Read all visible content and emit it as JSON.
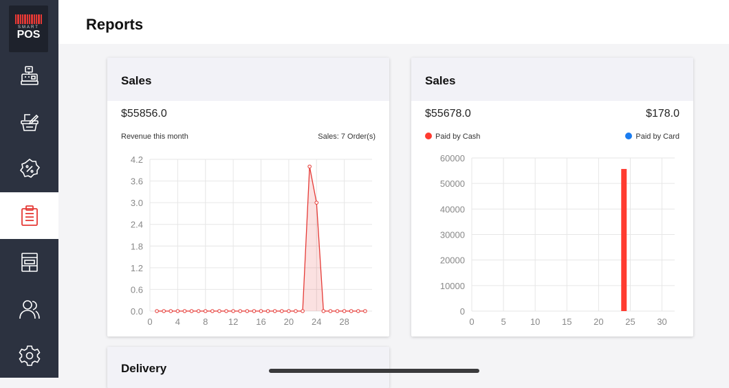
{
  "app": {
    "logo_small": "SMART",
    "logo_big": "POS"
  },
  "sidebar": {
    "items": [
      {
        "name": "register",
        "icon": "cash-register-icon",
        "active": false
      },
      {
        "name": "products",
        "icon": "basket-edit-icon",
        "active": false
      },
      {
        "name": "discounts",
        "icon": "percent-badge-icon",
        "active": false
      },
      {
        "name": "reports",
        "icon": "clipboard-icon",
        "active": true
      },
      {
        "name": "store",
        "icon": "storefront-icon",
        "active": false
      },
      {
        "name": "customers",
        "icon": "users-icon",
        "active": false
      },
      {
        "name": "settings",
        "icon": "gear-icon",
        "active": false
      }
    ],
    "accent": "#e53935"
  },
  "header": {
    "title": "Reports"
  },
  "cards": {
    "sales_trend": {
      "title": "Sales",
      "amount": "$55856.0",
      "revenue_label": "Revenue this month",
      "orders_label": "Sales: 7 Order(s)"
    },
    "sales_payment": {
      "title": "Sales",
      "cash_amount": "$55678.0",
      "card_amount": "$178.0",
      "cash_label": "Paid by Cash",
      "card_label": "Paid by Card",
      "cash_color": "#ff3b30",
      "card_color": "#1a7cf0"
    },
    "delivery": {
      "title": "Delivery"
    }
  },
  "chart_data": [
    {
      "type": "line",
      "x": [
        1,
        2,
        3,
        4,
        5,
        6,
        7,
        8,
        9,
        10,
        11,
        12,
        13,
        14,
        15,
        16,
        17,
        18,
        19,
        20,
        21,
        22,
        23,
        24,
        25,
        26,
        27,
        28,
        29,
        30,
        31
      ],
      "series": [
        {
          "values": [
            0,
            0,
            0,
            0,
            0,
            0,
            0,
            0,
            0,
            0,
            0,
            0,
            0,
            0,
            0,
            0,
            0,
            0,
            0,
            0,
            0,
            0,
            4,
            3,
            0,
            0,
            0,
            0,
            0,
            0,
            0
          ]
        }
      ],
      "xlim": [
        0,
        32
      ],
      "ylim": [
        0,
        4.2
      ],
      "xticks": [
        "0",
        "4",
        "8",
        "12",
        "16",
        "20",
        "24",
        "28"
      ],
      "yticks": [
        "0.0",
        "0.6",
        "1.2",
        "1.8",
        "2.4",
        "3.0",
        "3.6",
        "4.2"
      ],
      "color": "#e53935",
      "fill": "rgba(229,57,53,0.15)",
      "grid": true
    },
    {
      "type": "bar",
      "x": [
        24
      ],
      "values": [
        55678
      ],
      "xlim": [
        0,
        32
      ],
      "ylim": [
        0,
        60000
      ],
      "xticks": [
        "0",
        "5",
        "10",
        "15",
        "20",
        "25",
        "30"
      ],
      "yticks": [
        "0",
        "10000",
        "20000",
        "30000",
        "40000",
        "50000",
        "60000"
      ],
      "color": "#ff3b30",
      "grid": true
    }
  ]
}
